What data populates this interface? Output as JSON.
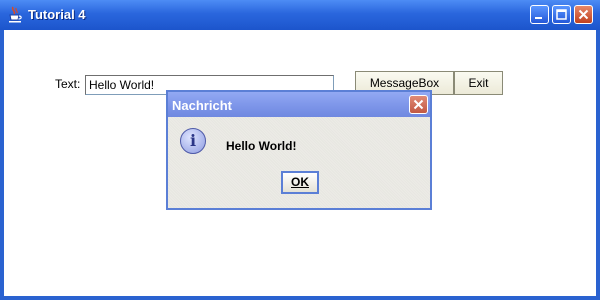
{
  "window": {
    "title": "Tutorial 4",
    "controls": {
      "minimize": "minimize",
      "maximize": "maximize",
      "close": "close"
    }
  },
  "form": {
    "text_label": "Text:",
    "text_value": "Hello World!",
    "messagebox_button": "MessageBox",
    "exit_button": "Exit"
  },
  "dialog": {
    "title": "Nachricht",
    "message": "Hello World!",
    "ok_button": "OK",
    "icon": "info-icon"
  },
  "colors": {
    "titlebar": "#2a66dd",
    "dialog_titlebar": "#7f97ea",
    "dialog_background": "#ecebe6",
    "button_background": "#fafaf1"
  }
}
